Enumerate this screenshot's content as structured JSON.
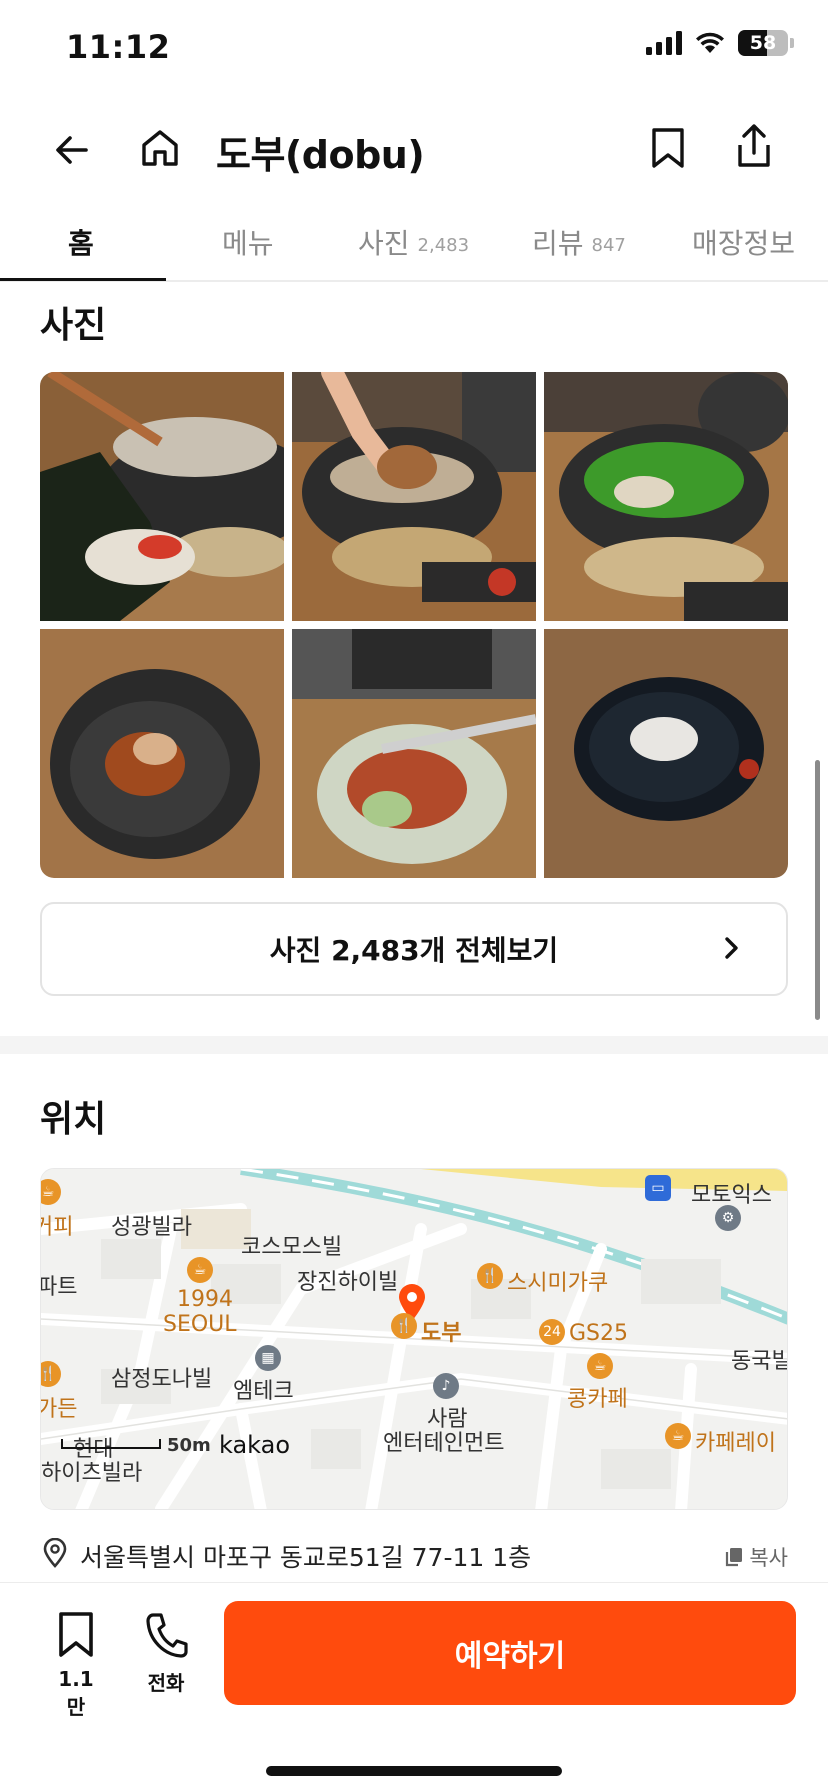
{
  "status_bar": {
    "time": "11:12",
    "battery": "58",
    "battery_level": 0.58
  },
  "header": {
    "title": "도부(dobu)"
  },
  "tabs": [
    {
      "label": "홈",
      "count": ""
    },
    {
      "label": "메뉴",
      "count": ""
    },
    {
      "label": "사진",
      "count": "2,483"
    },
    {
      "label": "리뷰",
      "count": "847"
    },
    {
      "label": "매장정보",
      "count": ""
    }
  ],
  "photos": {
    "section_title": "사진",
    "view_all_label": "사진 2,483개 전체보기"
  },
  "location": {
    "section_title": "위치",
    "address": "서울특별시 마포구 동교로51길 77-11 1층",
    "copy_label": "복사",
    "map_labels": {
      "cafe_left": "커피",
      "seonggwang": "성광빌라",
      "cosmos": "코스모스빌",
      "apt": "파트",
      "jangjin": "장진하이빌",
      "sushi": "스시미가쿠",
      "seoul_1994_a": "1994",
      "seoul_1994_b": "SEOUL",
      "dobu": "도부",
      "gs25": "GS25",
      "motoix": "모토익스",
      "donggug": "동국빌",
      "samjeong": "삼정도나빌",
      "emtech": "엠테크",
      "garden": "가든",
      "kongcafe": "콩카페",
      "saram_a": "사람",
      "saram_b": "엔터테인먼트",
      "hyundai": "현대",
      "scale": "50m",
      "kakao": "kakao",
      "cafe_ray": "카페레이",
      "villa_bottom": "하이츠빌라"
    }
  },
  "bottom_bar": {
    "save_count": "1.1만",
    "call_label": "전화",
    "reserve_label": "예약하기"
  },
  "colors": {
    "accent": "#ff4b0d",
    "map_orange": "#e89427"
  },
  "icons": [
    "back-arrow-icon",
    "home-icon",
    "bookmark-icon",
    "share-icon",
    "chevron-right-icon",
    "location-pin-icon",
    "copy-icon",
    "phone-icon"
  ]
}
